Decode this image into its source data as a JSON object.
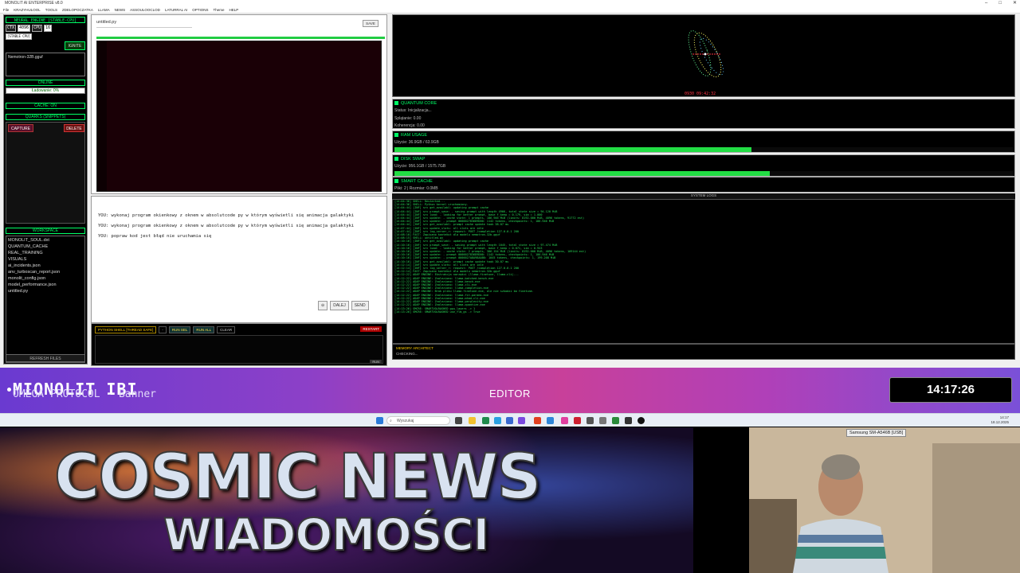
{
  "window": {
    "title": "MONOLIT AI ENTERPRISE v8.0",
    "menu": [
      "File",
      "KRAZYHULOOL",
      "TOOLS",
      "ZDELOPOCZATKA",
      "LLAMA",
      "NEWS",
      "ASSOULOOCLOD",
      "LATURRAL AI",
      "OPTIONS",
      "Theme",
      "HELP"
    ]
  },
  "sidebar": {
    "engine_header": "NEURAL ENGINE [STABLE-CPU]",
    "ctx_label": "CTX",
    "ctx_value": "4096",
    "cpu_label": "CPU",
    "cpu_value": "16",
    "stable_tag": "[STABLE CPU]",
    "ignite": "IGNITE",
    "model": "Nemotron-32B.gguf",
    "online": "ONLINE",
    "loading": "Ładowanie: 0%",
    "cache": "CACHE: ON",
    "quarks_header": "QUARKS (SNIPPETS)",
    "capture": "CAPTURE",
    "delete": "DELETE",
    "workspace_header": "WORKSPACE",
    "files": [
      "MONOLIT_SOUL.dxt",
      "QUANTUM_CACHE",
      "REAL_TRAINING",
      "VISUALS",
      "ai_incidents.json",
      "anv_turboscan_report.json",
      "monolit_config.json",
      "model_performance.json",
      "untitled.py"
    ],
    "refresh": "REFRESH FILES"
  },
  "editor": {
    "filename": "untitled.py",
    "save": "SAVE"
  },
  "chat": {
    "lines": [
      "YOU: wykonaj program okienkowy z oknem w absolutcode py w którym wyświetli się animacja galaktyki",
      "YOU: wykonaj program okienkowy z oknem w absolutcode py w którym wyświetli się animacja galaktyki",
      "YOU: popraw kod jest błąd nie uruchamia się"
    ],
    "stop": "⊖",
    "dalej": "DALEJ",
    "send": "SEND"
  },
  "shell": {
    "title": "PYTHON SHELL [THREAD SAFE]",
    "b1": "-",
    "run_sel": "RUN SEL",
    "run_all": "RUN ALL",
    "clear": "CLEAR",
    "restart": "RESTART",
    "run": "RUN"
  },
  "visual": {
    "clock": "0930 09:42:32"
  },
  "panels": {
    "quantum": {
      "title": "QUANTUM CORE",
      "status": "Status: Inicjalizacja...",
      "splatanie": "Splątanie: 0.00",
      "koherencja": "Koherencja: 0.00"
    },
    "ram": {
      "title": "RAM USAGE",
      "usage": "Użycie: 36.9GB / 63.9GB",
      "fraction": 0.577
    },
    "swap": {
      "title": "DISK SWAP",
      "usage": "Użycie: 956.1GB / 1575.7GB",
      "fraction": 0.607
    },
    "smart": {
      "title": "SMART CACHE",
      "info": "Pliki: 2 | Rozmiar: 0.0MB"
    }
  },
  "syslogs": {
    "label": "SYSTEM LOGS",
    "lines": [
      "[14:04:36] SHELL: Restarted...",
      "[14:04:36] SHELL: Python kernel uruchomiony.",
      "[14:04:44] [INF] srv  get_availabl: updating prompt cache",
      "[14:04:44] [INF] srv   prompt_save: - saving prompt with length 4966, total state size = 94.120 MiB",
      "[14:04:44] [INF] srv          load: - looking for better prompt, base f_keep = 0.179, sim = 1.000",
      "[14:04:44] [INF] srv        update: - cache state: 1 prompts, 186.946 MiB (limits: 8192.000 MiB, 4096 tokens, 91772 est)",
      "[14:04:44] [INF] srv        update: - prompt 0000027836D9D00: 1142 tokens, checkpoints: 1, 186.946 MiB",
      "[14:04:44] [INF] srv  get_availabl: prompt cache update took 38.07 ms",
      "[14:07:44] [INF] srv  update_slots: all slots are idle",
      "[14:07:44] [INF] srv  log_server_r: request: POST /completion 127.0.0.1 200",
      "[14:08:10] FAST: Zapisano kontekst dla modelu nemotron-32b.gguf",
      "[14:08:15] SHELL: untitled.py",
      "[14:10:16] [INF] srv  get_availabl: updating prompt cache",
      "[14:10:16] [INF] srv   prompt_save: - saving prompt with length 1045, total state size = 97.474 MiB",
      "[14:10:16] [INF] srv          load: - looking for better prompt, base f_keep = 0.071, sim = 0.943",
      "[14:10:16] [INF] srv        update: - cache state: 2 prompts, 386.154 MiB (limits: 8192.000 MiB, 4096 tokens, 109144 est)",
      "[14:10:16] [INF] srv        update: - prompt 0000027836D9D00: 1142 tokens, checkpoints: 1, 186.946 MiB",
      "[14:10:16] [INF] srv        update: - prompt 0000027A8A98AAB0: 1045 tokens, checkpoints: 1, 199.208 MiB",
      "[14:10:16] [INF] srv  get_availabl: prompt cache update took 30.07 ms",
      "[14:12:14] [INF] srv  update_slots: all slots are idle",
      "[14:12:14] [INF] srv  log_server_r: request: POST /completion 127.0.0.1 200",
      "[14:12:14] FAST: Zapisano kontekst dla modelu nemotron-32b.gguf",
      "[14:12:22] ADAP ENGINE: Ekstrakcja narzędzi (llama-finetune, llama-cli)...",
      "[14:12:22] ADAP ENGINE: Znaleziono: llama-batched-bench.exe",
      "[14:12:22] ADAP ENGINE: Znaleziono: llama-bench.exe",
      "[14:12:22] ADAP ENGINE: Znaleziono: llama-cli.exe",
      "[14:12:22] ADAP ENGINE: Znaleziono: llama-completion.exe",
      "[14:12:22] ADAP ENGINE: Brak pliku llama-finetune.exe, ale nie szkodzi bo finetune.",
      "[14:12:22] ADAP ENGINE: Znaleziono: llama-fit-params.exe",
      "[14:12:22] ADAP ENGINE: Znaleziono: llama-mtmd-cli.exe",
      "[14:12:22] ADAP ENGINE: Znaleziono: llama-perplexity.exe",
      "[14:12:22] ADAP ENGINE: Znaleziono: llama-quantize.exe",
      "[14:13:26] SMCRE: SMARTVOLRASHED gpu_layers -> 1",
      "[14:13:26] SMCRE: SMARTVOLRASHED use_flm_gs -> True"
    ]
  },
  "memory": {
    "title": "MEMORY ARCHITECT",
    "status": "CHECKING..."
  },
  "banner": {
    "title": "MIONOLIT IBI",
    "subtitle": "OMEGA PROTOCOL - Banner",
    "mode": "EDITOR",
    "clock": "14:17:26"
  },
  "taskbar": {
    "search": "Wyszukaj",
    "time": "14:17",
    "date": "18.12.2025"
  },
  "stream": {
    "line1": "COSMIC NEWS",
    "line2": "WIADOMOŚCI",
    "cam_label": "Samsung SM-A546B [USB]"
  },
  "colors": {
    "accent_green": "#22dd44",
    "banner_purple": "#6a3ad0",
    "banner_pink": "#c8409a"
  }
}
